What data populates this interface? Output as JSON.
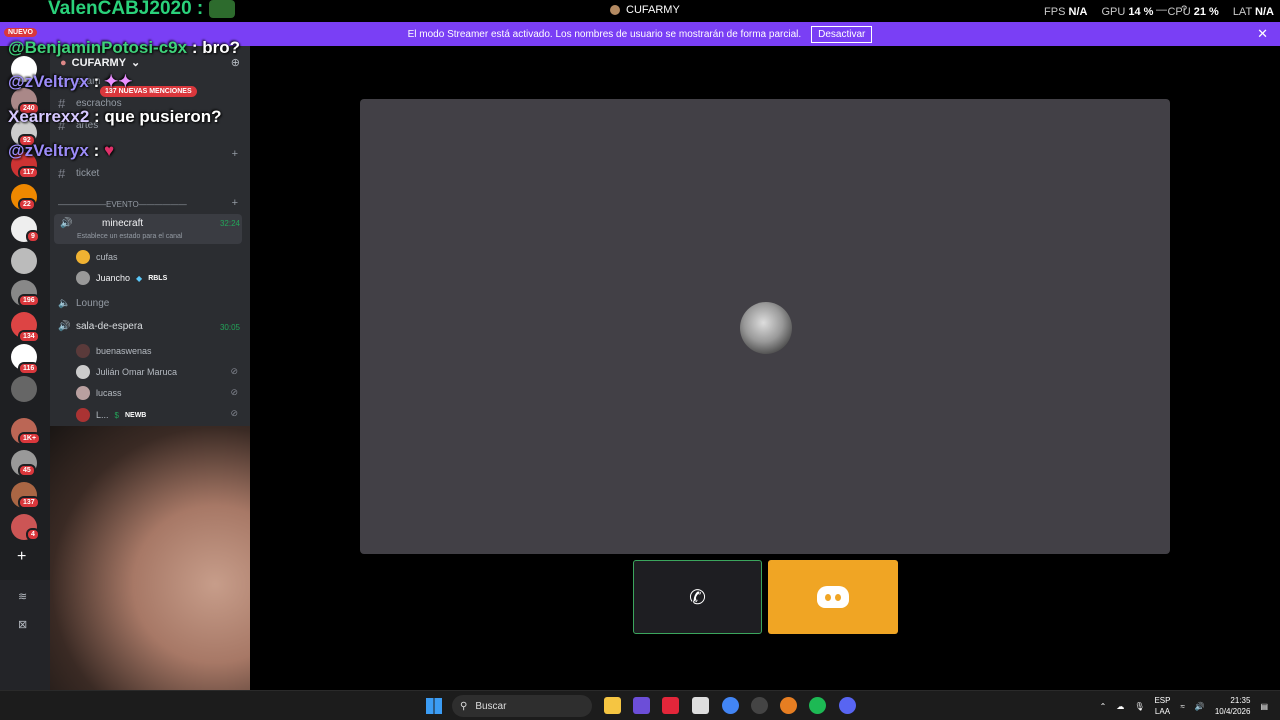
{
  "title_bar": {
    "title": "CUFARMY",
    "stats": [
      {
        "label": "FPS",
        "value": "N/A"
      },
      {
        "label": "GPU",
        "value": "14 %"
      },
      {
        "label": "CPU",
        "value": "21 %"
      },
      {
        "label": "LAT",
        "value": "N/A"
      }
    ]
  },
  "banner": {
    "text": "El modo Streamer está activado. Los nombres de usuario se mostrarán de forma parcial.",
    "button": "Desactivar",
    "close": "✕"
  },
  "rail": {
    "nuevo": "NUEVO",
    "badges": [
      "240",
      "92",
      "117",
      "22",
      "9",
      "196",
      "134",
      "116",
      "1K+",
      "45",
      "137",
      "4"
    ],
    "add": "+"
  },
  "server": {
    "name": "CUFARMY",
    "mentions": "137 NUEVAS MENCIONES",
    "channels": [
      {
        "name": "spam"
      },
      {
        "name": "escrachos"
      },
      {
        "name": "artes"
      },
      {
        "name": "ticket"
      }
    ],
    "category_event": "——————EVENTO——————",
    "voice_active": {
      "name": "minecraft",
      "time": "32:24",
      "status": "Establece un estado para el canal"
    },
    "voice_users_1": [
      {
        "name": "cufas",
        "tag": ""
      },
      {
        "name": "Juancho",
        "tag": "RBLS"
      }
    ],
    "lounge": "Lounge",
    "voice_2": {
      "name": "sala-de-espera",
      "time": "30:05"
    },
    "voice_users_2": [
      {
        "name": "buenaswenas",
        "tag": ""
      },
      {
        "name": "Julián Omar Maruca",
        "tag": ""
      },
      {
        "name": "lucass",
        "tag": ""
      },
      {
        "name": "L...",
        "tag": "NEWB"
      }
    ]
  },
  "chat_overlay": {
    "top": "ValenCABJ2020 :",
    "lines": [
      {
        "user": "@BenjaminPotosi-c9x",
        "msg": ": bro?"
      },
      {
        "user": "@zVeltryx",
        "msg": ":"
      },
      {
        "user": "Xearrexx2",
        "msg": ": que pusieron?"
      },
      {
        "user": "@zVeltryx",
        "msg": ":"
      }
    ]
  },
  "taskbar": {
    "search": "Buscar",
    "lang1": "ESP",
    "lang2": "LAA",
    "time": "21:35",
    "date": "10/4/2026"
  },
  "colors": {
    "banner": "#7a3ff5",
    "accent_green": "#3ba55d",
    "discord_button": "#f0a524",
    "video_tile": "#424046"
  }
}
